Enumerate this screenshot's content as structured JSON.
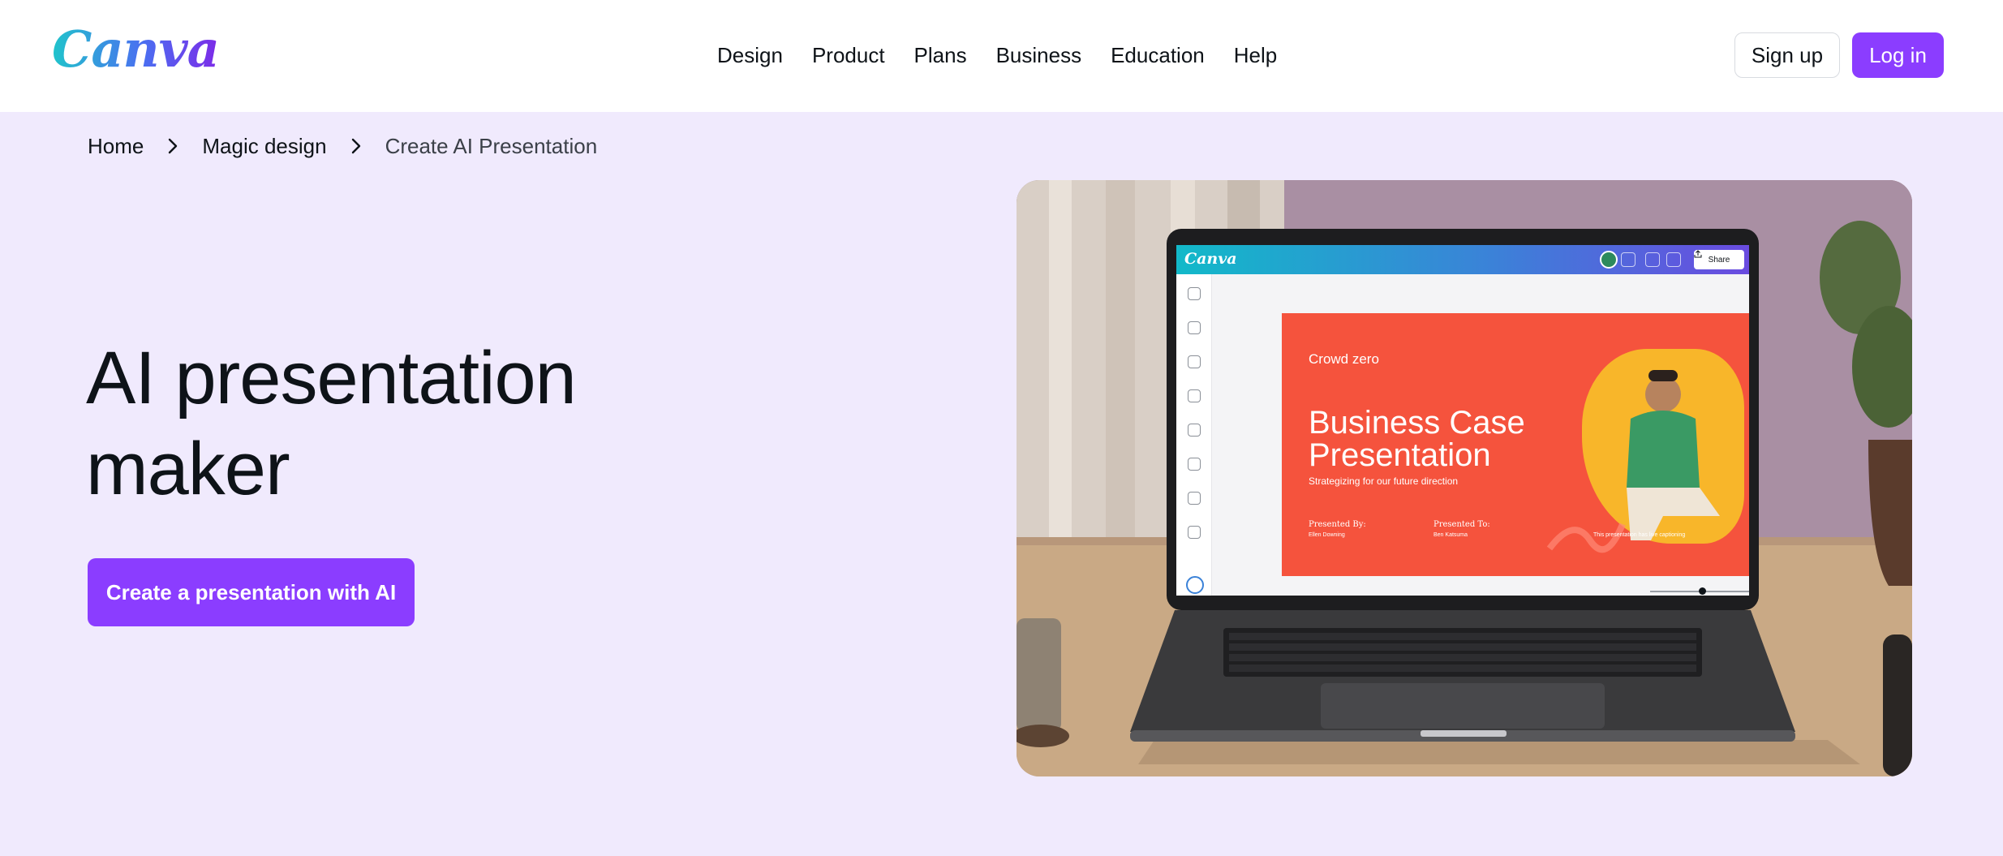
{
  "brand": {
    "logo_text": "Canva",
    "accent": "#8b3dff",
    "background": "#f0eafd"
  },
  "nav": {
    "items": [
      {
        "label": "Design"
      },
      {
        "label": "Product"
      },
      {
        "label": "Plans"
      },
      {
        "label": "Business"
      },
      {
        "label": "Education"
      },
      {
        "label": "Help"
      }
    ]
  },
  "auth": {
    "signup_label": "Sign up",
    "login_label": "Log in"
  },
  "breadcrumb": {
    "items": [
      {
        "label": "Home"
      },
      {
        "label": "Magic design"
      },
      {
        "label": "Create AI Presentation"
      }
    ],
    "separator_icon": "chevron-right-icon"
  },
  "hero": {
    "title_line1": "AI presentation",
    "title_line2": "maker",
    "cta_label": "Create a presentation with AI"
  },
  "hero_image": {
    "app_logo": "Canva",
    "share_label": "Share",
    "slide": {
      "brand": "Crowd zero",
      "title_line1": "Business Case",
      "title_line2": "Presentation",
      "subtitle": "Strategizing for our future direction",
      "presented_by_label": "Presented By:",
      "presented_by_name": "Ellen Downing",
      "presented_to_label": "Presented To:",
      "presented_to_name": "Ben Katsuma",
      "note": "This presentation has live captioning"
    }
  }
}
